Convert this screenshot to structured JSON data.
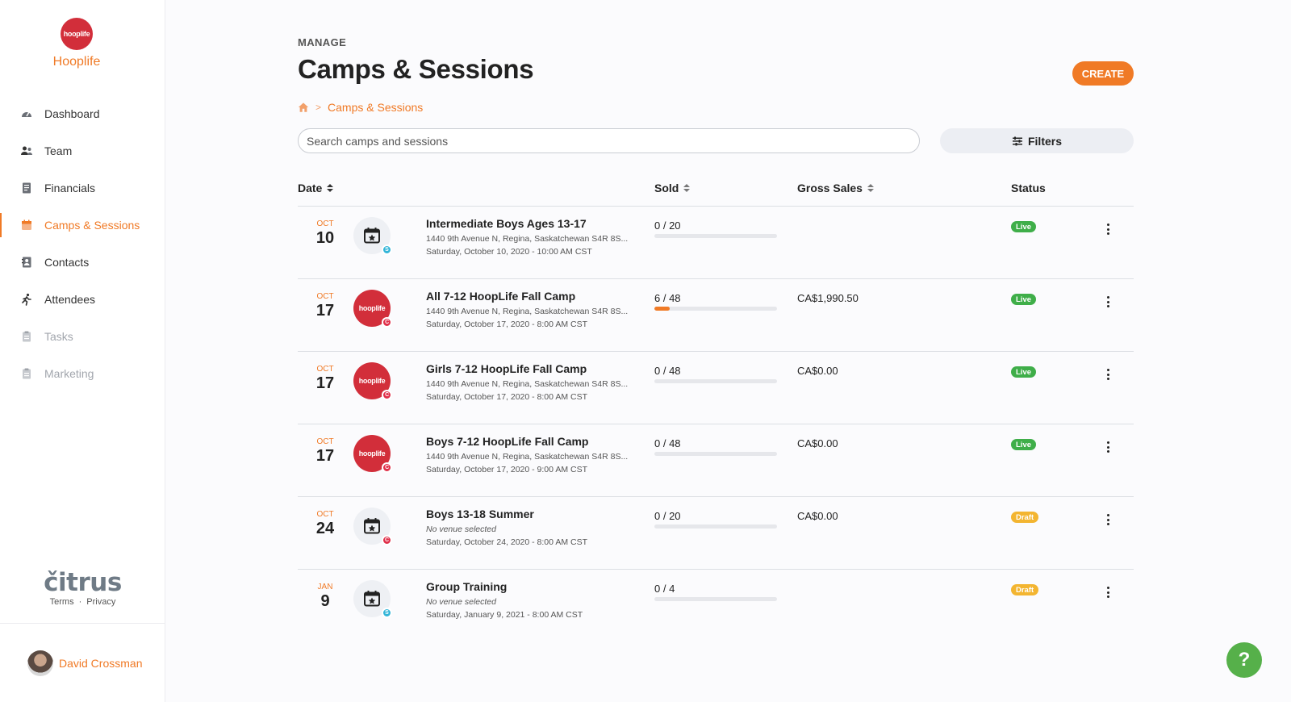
{
  "brand": {
    "logo_text": "hooplife",
    "name": "Hooplife"
  },
  "sidebar": {
    "items": [
      {
        "label": "Dashboard",
        "icon": "gauge-icon"
      },
      {
        "label": "Team",
        "icon": "people-icon"
      },
      {
        "label": "Financials",
        "icon": "receipt-icon"
      },
      {
        "label": "Camps & Sessions",
        "icon": "calendar-icon",
        "active": true
      },
      {
        "label": "Contacts",
        "icon": "contacts-icon"
      },
      {
        "label": "Attendees",
        "icon": "runner-icon"
      },
      {
        "label": "Tasks",
        "icon": "clipboard-icon",
        "muted": true
      },
      {
        "label": "Marketing",
        "icon": "clipboard-icon",
        "muted": true
      }
    ]
  },
  "footer": {
    "logo": "čitrus",
    "terms": "Terms",
    "dot": "·",
    "privacy": "Privacy"
  },
  "user": {
    "name": "David Crossman"
  },
  "header": {
    "eyebrow": "MANAGE",
    "title": "Camps & Sessions",
    "create_label": "CREATE"
  },
  "breadcrumb": {
    "separator": ">",
    "current": "Camps & Sessions"
  },
  "search": {
    "placeholder": "Search camps and sessions",
    "value": ""
  },
  "filters_label": "Filters",
  "table": {
    "columns": {
      "date": "Date",
      "sold": "Sold",
      "gross": "Gross Sales",
      "status": "Status"
    },
    "rows": [
      {
        "month": "OCT",
        "day": "10",
        "thumb": "calendar",
        "badge": "S",
        "title": "Intermediate Boys Ages 13-17",
        "address": "1440 9th Avenue N, Regina, Saskatchewan S4R 8S...",
        "address_italic": false,
        "when": "Saturday, October 10, 2020 - 10:00 AM CST",
        "sold": "0 / 20",
        "sold_fraction": 0,
        "gross": "",
        "status": "Live"
      },
      {
        "month": "OCT",
        "day": "17",
        "thumb": "logo",
        "badge": "C",
        "title": "All 7-12 HoopLife Fall Camp",
        "address": "1440 9th Avenue N, Regina, Saskatchewan S4R 8S...",
        "address_italic": false,
        "when": "Saturday, October 17, 2020 - 8:00 AM CST",
        "sold": "6 / 48",
        "sold_fraction": 0.125,
        "gross": "CA$1,990.50",
        "status": "Live"
      },
      {
        "month": "OCT",
        "day": "17",
        "thumb": "logo",
        "badge": "C",
        "title": "Girls 7-12 HoopLife Fall Camp",
        "address": "1440 9th Avenue N, Regina, Saskatchewan S4R 8S...",
        "address_italic": false,
        "when": "Saturday, October 17, 2020 - 8:00 AM CST",
        "sold": "0 / 48",
        "sold_fraction": 0,
        "gross": "CA$0.00",
        "status": "Live"
      },
      {
        "month": "OCT",
        "day": "17",
        "thumb": "logo",
        "badge": "C",
        "title": "Boys 7-12 HoopLife Fall Camp",
        "address": "1440 9th Avenue N, Regina, Saskatchewan S4R 8S...",
        "address_italic": false,
        "when": "Saturday, October 17, 2020 - 9:00 AM CST",
        "sold": "0 / 48",
        "sold_fraction": 0,
        "gross": "CA$0.00",
        "status": "Live"
      },
      {
        "month": "OCT",
        "day": "24",
        "thumb": "calendar",
        "badge": "C",
        "title": "Boys 13-18 Summer",
        "address": "No venue selected",
        "address_italic": true,
        "when": "Saturday, October 24, 2020 - 8:00 AM CST",
        "sold": "0 / 20",
        "sold_fraction": 0,
        "gross": "CA$0.00",
        "status": "Draft"
      },
      {
        "month": "JAN",
        "day": "9",
        "thumb": "calendar",
        "badge": "S",
        "title": "Group Training",
        "address": "No venue selected",
        "address_italic": true,
        "when": "Saturday, January 9, 2021 - 8:00 AM CST",
        "sold": "0 / 4",
        "sold_fraction": 0,
        "gross": "",
        "status": "Draft"
      }
    ]
  },
  "help_label": "?",
  "colors": {
    "accent": "#f07a26",
    "brand_red": "#d22e3a",
    "live": "#3fae49",
    "draft": "#f3b531",
    "help": "#56b04a"
  }
}
